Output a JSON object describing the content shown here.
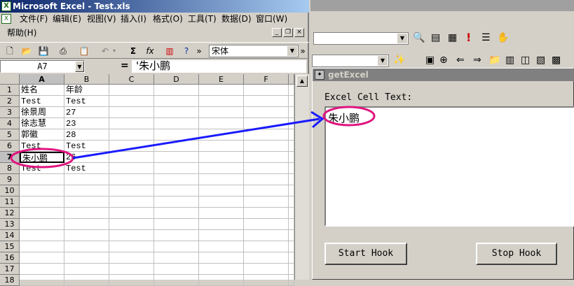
{
  "excel": {
    "title": "Microsoft Excel - Test.xls",
    "menu": [
      "文件(F)",
      "编辑(E)",
      "视图(V)",
      "插入(I)",
      "格式(O)",
      "工具(T)",
      "数据(D)",
      "窗口(W)"
    ],
    "menu2": [
      "帮助(H)"
    ],
    "font_name": "宋体",
    "name_box": "A7",
    "formula_eq": "=",
    "formula_value": "'朱小鹏",
    "columns": [
      "A",
      "B",
      "C",
      "D",
      "E",
      "F"
    ],
    "rows": [
      {
        "n": "1",
        "a": "姓名",
        "b": "年龄"
      },
      {
        "n": "2",
        "a": "Test",
        "b": "Test"
      },
      {
        "n": "3",
        "a": "徐景周",
        "b": "27"
      },
      {
        "n": "4",
        "a": "徐志慧",
        "b": "23"
      },
      {
        "n": "5",
        "a": "郭徽",
        "b": "28"
      },
      {
        "n": "6",
        "a": "Test",
        "b": "Test"
      },
      {
        "n": "7",
        "a": "朱小鹏",
        "b": "26"
      },
      {
        "n": "8",
        "a": "Test",
        "b": "Test"
      },
      {
        "n": "9",
        "a": "",
        "b": ""
      },
      {
        "n": "10",
        "a": "",
        "b": ""
      },
      {
        "n": "11",
        "a": "",
        "b": ""
      },
      {
        "n": "12",
        "a": "",
        "b": ""
      },
      {
        "n": "13",
        "a": "",
        "b": ""
      },
      {
        "n": "14",
        "a": "",
        "b": ""
      },
      {
        "n": "15",
        "a": "",
        "b": ""
      },
      {
        "n": "16",
        "a": "",
        "b": ""
      },
      {
        "n": "17",
        "a": "",
        "b": ""
      },
      {
        "n": "18",
        "a": "",
        "b": ""
      }
    ]
  },
  "dialog": {
    "title": "getExcel",
    "label": "Excel Cell Text:",
    "text": "朱小鹏",
    "start_button": "Start Hook",
    "stop_button": "Stop Hook"
  },
  "colors": {
    "highlight": "#e0157f",
    "arrow": "#1a1aff"
  }
}
